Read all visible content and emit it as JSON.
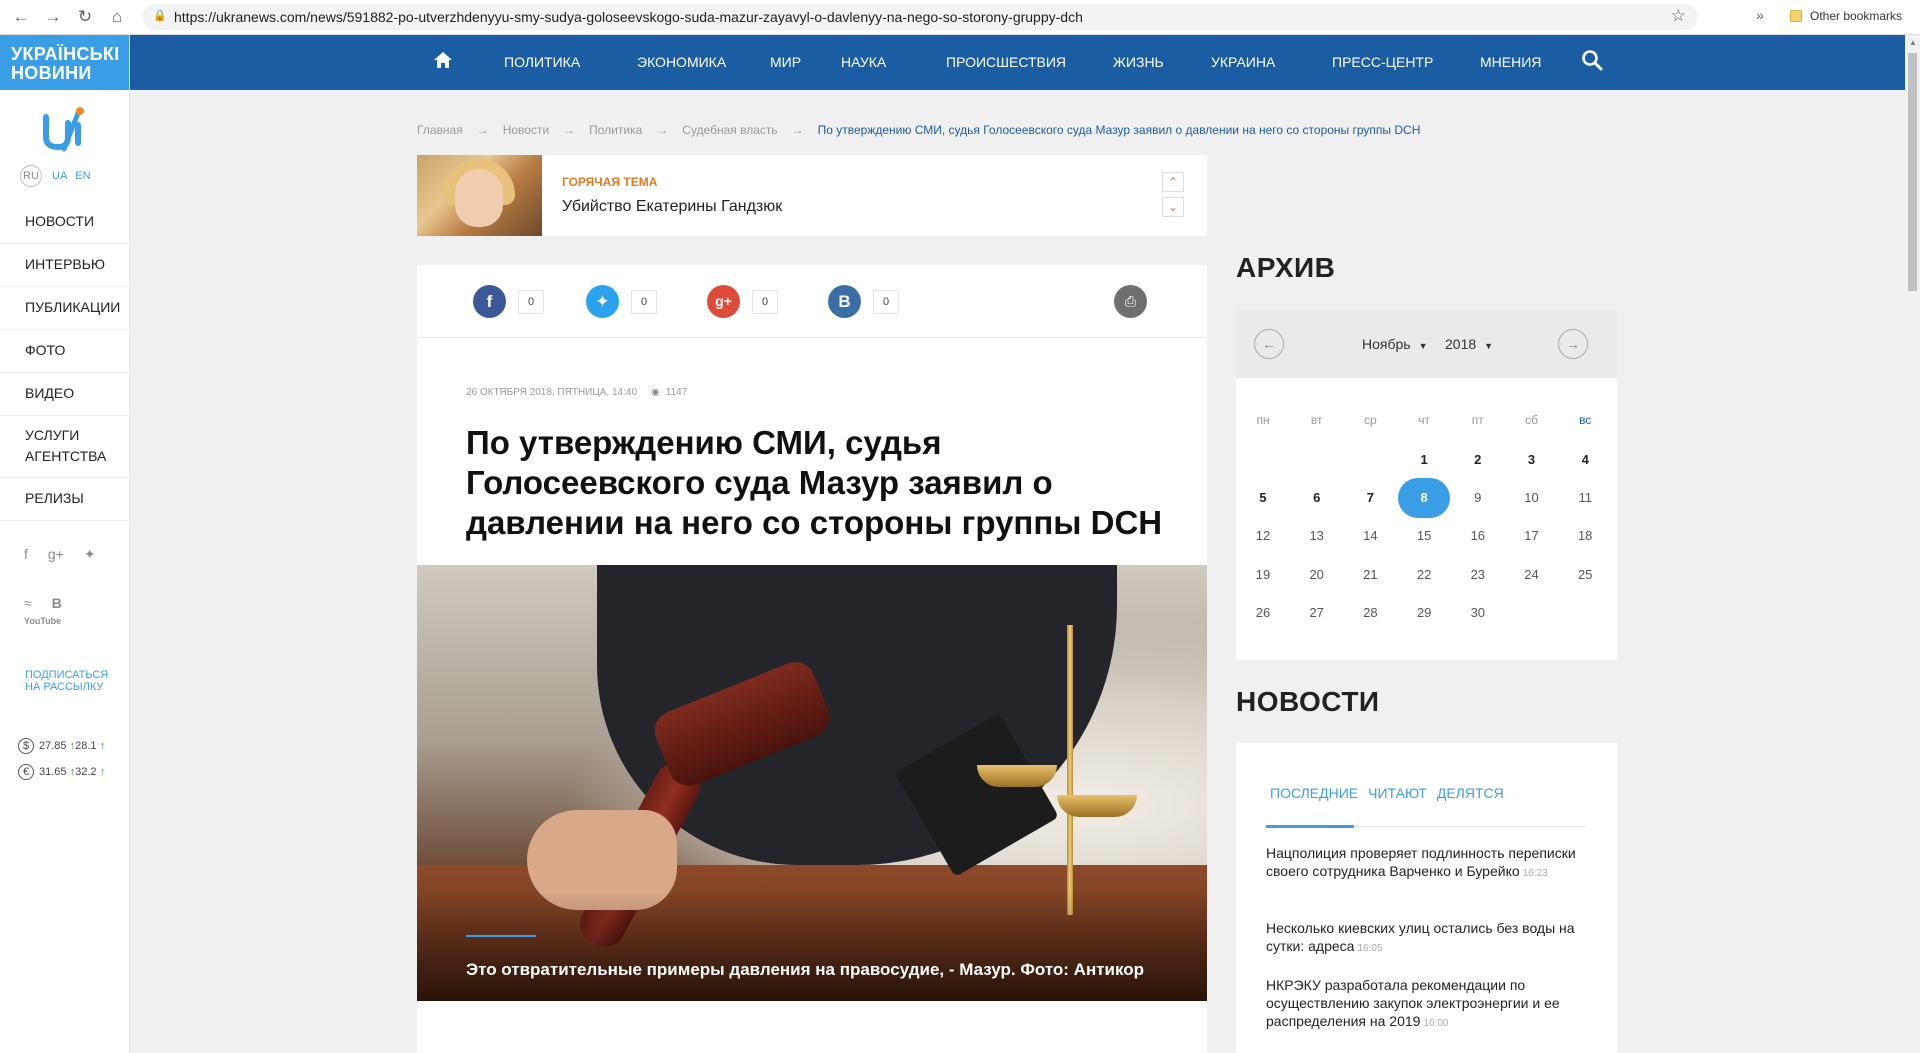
{
  "browser": {
    "url": "https://ukranews.com/news/591882-po-utverzhdenyyu-smy-sudya-goloseevskogo-suda-mazur-zayavyl-o-davlenyy-na-nego-so-storony-gruppy-dch",
    "bookmarks_label": "Other bookmarks"
  },
  "sidebar": {
    "brand": [
      "УКРАЇНСЬКІ",
      "НОВИНИ"
    ],
    "langs": [
      "RU",
      "UA",
      "EN"
    ],
    "menu": [
      "НОВОСТИ",
      "ИНТЕРВЬЮ",
      "ПУБЛИКАЦИИ",
      "ФОТО",
      "ВИДЕО",
      "УСЛУГИ АГЕНТСТВА",
      "РЕЛИЗЫ"
    ],
    "subscribe": [
      "ПОДПИСАТЬСЯ",
      "НА РАССЫЛКУ"
    ],
    "rates": [
      {
        "symbol": "$",
        "buy": "27.85",
        "sell": "28.1"
      },
      {
        "symbol": "€",
        "buy": "31.65",
        "sell": "32.2"
      }
    ],
    "youtube_label": "YouTube"
  },
  "topnav": [
    "ПОЛИТИКА",
    "ЭКОНОМИКА",
    "МИР",
    "НАУКА",
    "ПРОИСШЕСТВИЯ",
    "ЖИЗНЬ",
    "УКРАИНА",
    "ПРЕСС-ЦЕНТР",
    "МНЕНИЯ"
  ],
  "breadcrumb": {
    "items": [
      "Главная",
      "Новости",
      "Политика",
      "Судебная власть"
    ],
    "current": "По утверждению СМИ, судья Голосеевского суда Мазур заявил о давлении на него со стороны группы DCH"
  },
  "hot_topic": {
    "tag": "ГОРЯЧАЯ ТЕМА",
    "title": "Убийство Екатерины Гандзюк"
  },
  "share": {
    "facebook": "0",
    "twitter": "0",
    "googleplus": "0",
    "vk": "0"
  },
  "article": {
    "date": "26 ОКТЯБРЯ 2018, ПЯТНИЦА, 14:40",
    "views": "1147",
    "headline": "По утверждению СМИ, судья Голосеевского суда Мазур заявил о давлении на него со стороны группы DCH",
    "caption": "Это отвратительные примеры давления на правосудие, - Мазур. Фото: Антикор"
  },
  "archive": {
    "title": "АРХИВ",
    "month": "Ноябрь",
    "year": "2018",
    "weekdays": [
      "пн",
      "вт",
      "ср",
      "чт",
      "пт",
      "сб",
      "вс"
    ],
    "first_weekday_index": 3,
    "days_in_month": 30,
    "today": 8,
    "bold_days": [
      1,
      2,
      3,
      4,
      5,
      6,
      7,
      8
    ]
  },
  "news": {
    "title": "НОВОСТИ",
    "tabs": [
      "ПОСЛЕДНИЕ",
      "ЧИТАЮТ",
      "ДЕЛЯТСЯ"
    ],
    "items": [
      {
        "text": "Нацполиция проверяет подлинность переписки своего сотрудника Варченко и Бурейко",
        "time": "16:23"
      },
      {
        "text": "Несколько киевских улиц остались без воды на сутки: адреса",
        "time": "16:05"
      },
      {
        "text": "НКРЭКУ разработала рекомендации по осуществлению закупок электроэнергии и ее распределения на 2019",
        "time": "16:00"
      }
    ]
  }
}
